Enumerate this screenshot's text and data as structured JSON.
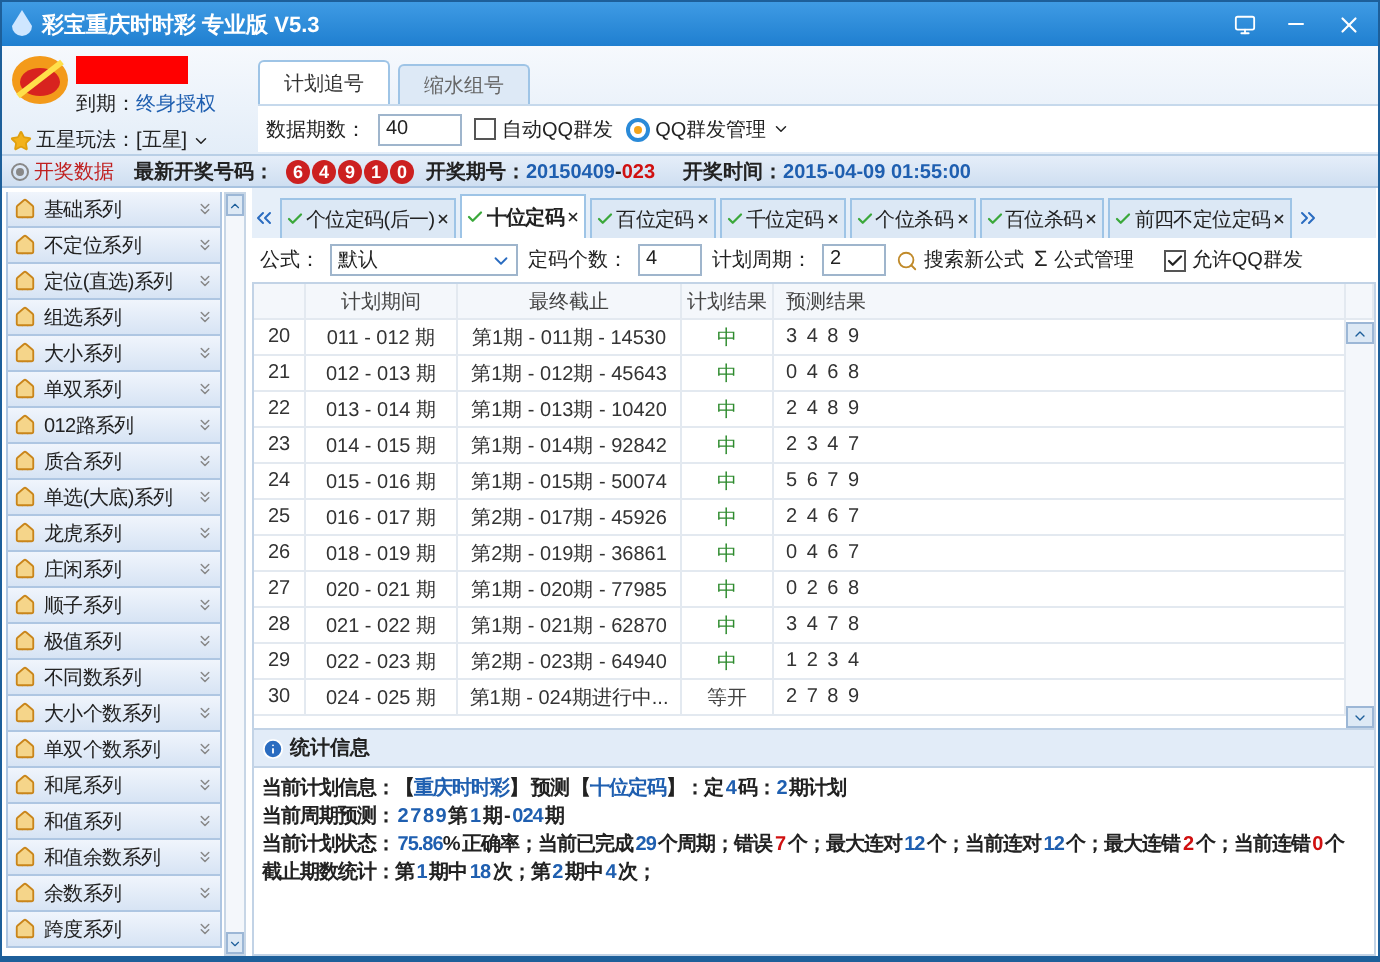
{
  "window": {
    "title": "彩宝重庆时时彩  专业版 V5.3"
  },
  "account": {
    "expiry_label": "到期：",
    "expiry_value": "终身授权"
  },
  "main_tabs": [
    {
      "label": "计划追号",
      "selected": true
    },
    {
      "label": "缩水组号",
      "selected": false
    }
  ],
  "mode": {
    "label": "五星玩法：[五星]"
  },
  "data_count": {
    "label": "数据期数：",
    "value": "40"
  },
  "auto_qq": {
    "label": "自动QQ群发",
    "checked": false
  },
  "qq_manage": {
    "label": "QQ群发管理"
  },
  "draw_bar": {
    "data_button": "开奖数据",
    "latest_label": "最新开奖号码：",
    "balls": [
      "6",
      "4",
      "9",
      "1",
      "0"
    ],
    "period_label": "开奖期号：",
    "period_date": "20150409",
    "period_sep": "-",
    "period_no": "023",
    "time_label": "开奖时间：",
    "time_value": "2015-04-09 01:55:00"
  },
  "sidebar": {
    "items": [
      {
        "label": "基础系列"
      },
      {
        "label": "不定位系列"
      },
      {
        "label": "定位(直选)系列"
      },
      {
        "label": "组选系列"
      },
      {
        "label": "大小系列"
      },
      {
        "label": "单双系列"
      },
      {
        "label": "012路系列"
      },
      {
        "label": "质合系列"
      },
      {
        "label": "单选(大底)系列"
      },
      {
        "label": "龙虎系列"
      },
      {
        "label": "庄闲系列"
      },
      {
        "label": "顺子系列"
      },
      {
        "label": "极值系列"
      },
      {
        "label": "不同数系列"
      },
      {
        "label": "大小个数系列"
      },
      {
        "label": "单双个数系列"
      },
      {
        "label": "和尾系列"
      },
      {
        "label": "和值系列"
      },
      {
        "label": "和值余数系列"
      },
      {
        "label": "余数系列"
      },
      {
        "label": "跨度系列"
      }
    ]
  },
  "plan_tabs": [
    {
      "label": "个位定码(后一)",
      "selected": false
    },
    {
      "label": "十位定码",
      "selected": true
    },
    {
      "label": "百位定码",
      "selected": false
    },
    {
      "label": "千位定码",
      "selected": false
    },
    {
      "label": "个位杀码",
      "selected": false
    },
    {
      "label": "百位杀码",
      "selected": false
    },
    {
      "label": "前四不定位定码",
      "selected": false
    }
  ],
  "formula_bar": {
    "formula_label": "公式：",
    "formula_value": "默认",
    "count_label": "定码个数：",
    "count_value": "4",
    "cycle_label": "计划周期：",
    "cycle_value": "2",
    "search_button": "搜索新公式",
    "manage_icon": "Σ",
    "manage_button": "公式管理",
    "allow_qq": {
      "label": "允许QQ群发",
      "checked": true
    }
  },
  "table": {
    "columns": [
      "计划期间",
      "最终截止",
      "计划结果",
      "预测结果"
    ],
    "rows": [
      {
        "index": "20",
        "period": "011 - 012 期",
        "deadline": "第1期 - 011期 - 14530",
        "result": "中",
        "hit": true,
        "prediction": "3 4 8 9"
      },
      {
        "index": "21",
        "period": "012 - 013 期",
        "deadline": "第1期 - 012期 - 45643",
        "result": "中",
        "hit": true,
        "prediction": "0 4 6 8"
      },
      {
        "index": "22",
        "period": "013 - 014 期",
        "deadline": "第1期 - 013期 - 10420",
        "result": "中",
        "hit": true,
        "prediction": "2 4 8 9"
      },
      {
        "index": "23",
        "period": "014 - 015 期",
        "deadline": "第1期 - 014期 - 92842",
        "result": "中",
        "hit": true,
        "prediction": "2 3 4 7"
      },
      {
        "index": "24",
        "period": "015 - 016 期",
        "deadline": "第1期 - 015期 - 50074",
        "result": "中",
        "hit": true,
        "prediction": "5 6 7 9"
      },
      {
        "index": "25",
        "period": "016 - 017 期",
        "deadline": "第2期 - 017期 - 45926",
        "result": "中",
        "hit": true,
        "prediction": "2 4 6 7"
      },
      {
        "index": "26",
        "period": "018 - 019 期",
        "deadline": "第2期 - 019期 - 36861",
        "result": "中",
        "hit": true,
        "prediction": "0 4 6 7"
      },
      {
        "index": "27",
        "period": "020 - 021 期",
        "deadline": "第1期 - 020期 - 77985",
        "result": "中",
        "hit": true,
        "prediction": "0 2 6 8"
      },
      {
        "index": "28",
        "period": "021 - 022 期",
        "deadline": "第1期 - 021期 - 62870",
        "result": "中",
        "hit": true,
        "prediction": "3 4 7 8"
      },
      {
        "index": "29",
        "period": "022 - 023 期",
        "deadline": "第2期 - 023期 - 64940",
        "result": "中",
        "hit": true,
        "prediction": "1 2 3 4"
      },
      {
        "index": "30",
        "period": "024 - 025 期",
        "deadline": "第1期 - 024期进行中...",
        "result": "等开",
        "hit": false,
        "prediction": "2 7 8 9"
      }
    ]
  },
  "stats": {
    "title": "统计信息",
    "lines": [
      [
        {
          "kind": "text",
          "text": "当前计划信息：【"
        },
        {
          "kind": "value",
          "text": "重庆时时彩"
        },
        {
          "kind": "text",
          "text": "】 预测 【"
        },
        {
          "kind": "value",
          "text": "十位定码"
        },
        {
          "kind": "text",
          "text": "】：定 "
        },
        {
          "kind": "value",
          "text": "4"
        },
        {
          "kind": "text",
          "text": " 码："
        },
        {
          "kind": "value",
          "text": "2"
        },
        {
          "kind": "text",
          "text": " 期计划"
        }
      ],
      [
        {
          "kind": "text",
          "text": "当前周期预测： "
        },
        {
          "kind": "value",
          "text": "2 7 8 9"
        },
        {
          "kind": "text",
          "text": " 第 "
        },
        {
          "kind": "value",
          "text": "1"
        },
        {
          "kind": "text",
          "text": " 期 - "
        },
        {
          "kind": "value",
          "text": "024"
        },
        {
          "kind": "text",
          "text": " 期"
        }
      ],
      [
        {
          "kind": "text",
          "text": "当前计划状态： "
        },
        {
          "kind": "value",
          "text": "75.86"
        },
        {
          "kind": "text",
          "text": "% 正确率；当前已完成 "
        },
        {
          "kind": "value",
          "text": "29"
        },
        {
          "kind": "text",
          "text": " 个周期；错误 "
        },
        {
          "kind": "alert",
          "text": "7"
        },
        {
          "kind": "text",
          "text": " 个；最大连对 "
        },
        {
          "kind": "value",
          "text": "12"
        },
        {
          "kind": "text",
          "text": " 个；当前连对 "
        },
        {
          "kind": "value",
          "text": "12"
        },
        {
          "kind": "text",
          "text": " 个；最大连错 "
        },
        {
          "kind": "alert",
          "text": "2"
        },
        {
          "kind": "text",
          "text": " 个；当前连错 "
        },
        {
          "kind": "alert",
          "text": "0"
        },
        {
          "kind": "text",
          "text": " 个"
        }
      ],
      [
        {
          "kind": "text",
          "text": "截止期数统计：第 "
        },
        {
          "kind": "value",
          "text": "1"
        },
        {
          "kind": "text",
          "text": " 期中 "
        },
        {
          "kind": "value",
          "text": "18"
        },
        {
          "kind": "text",
          "text": " 次；第 "
        },
        {
          "kind": "value",
          "text": "2"
        },
        {
          "kind": "text",
          "text": " 期中 "
        },
        {
          "kind": "value",
          "text": "4"
        },
        {
          "kind": "text",
          "text": " 次；"
        }
      ]
    ]
  }
}
